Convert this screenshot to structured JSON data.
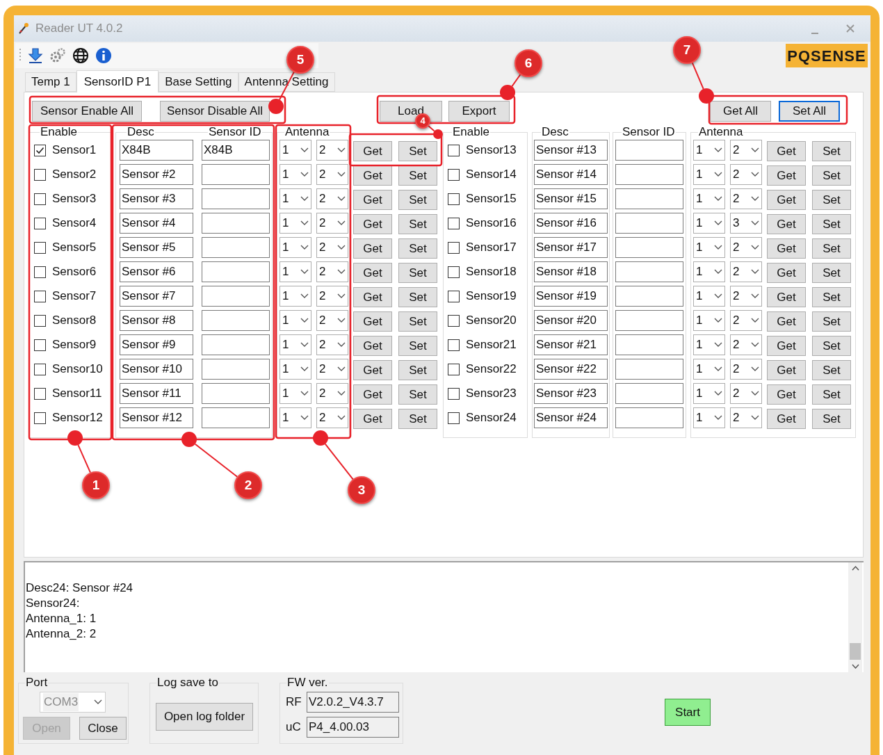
{
  "window": {
    "title": "Reader UT 4.0.2"
  },
  "logo": "PQSENSE",
  "tabs": [
    {
      "label": "Temp 1",
      "selected": false
    },
    {
      "label": "SensorID P1",
      "selected": true
    },
    {
      "label": "Base Setting",
      "selected": false
    },
    {
      "label": "Antenna Setting",
      "selected": false
    }
  ],
  "top_buttons": [
    {
      "label": "Sensor Enable All",
      "focused": false
    },
    {
      "label": "Sensor Disable All",
      "focused": false
    },
    {
      "label": "Load",
      "focused": false
    },
    {
      "label": "Export",
      "focused": false
    },
    {
      "label": "Get All",
      "focused": false
    },
    {
      "label": "Set All",
      "focused": true
    }
  ],
  "left_group_headers": [
    "Enable",
    "Desc",
    "Sensor ID",
    "Antenna"
  ],
  "right_group_headers": [
    "Enable",
    "Desc",
    "Sensor ID",
    "Antenna"
  ],
  "sensors": [
    {
      "label": "Sensor1",
      "checked": true,
      "desc": "X84B",
      "sensor_id": "X84B",
      "antenna_1": "1",
      "antenna_2": "2",
      "get": "Get",
      "set": "Set"
    },
    {
      "label": "Sensor2",
      "checked": false,
      "desc": "Sensor #2",
      "antenna_1": "1",
      "antenna_2": "2",
      "get": "Get",
      "set": "Set"
    },
    {
      "label": "Sensor3",
      "checked": false,
      "desc": "Sensor #3",
      "antenna_1": "1",
      "antenna_2": "2",
      "get": "Get",
      "set": "Set"
    },
    {
      "label": "Sensor4",
      "checked": false,
      "desc": "Sensor #4",
      "antenna_1": "1",
      "antenna_2": "2",
      "get": "Get",
      "set": "Set"
    },
    {
      "label": "Sensor5",
      "checked": false,
      "desc": "Sensor #5",
      "antenna_1": "1",
      "antenna_2": "2",
      "get": "Get",
      "set": "Set"
    },
    {
      "label": "Sensor6",
      "checked": false,
      "desc": "Sensor #6",
      "antenna_1": "1",
      "antenna_2": "2",
      "get": "Get",
      "set": "Set"
    },
    {
      "label": "Sensor7",
      "checked": false,
      "desc": "Sensor #7",
      "antenna_1": "1",
      "antenna_2": "2",
      "get": "Get",
      "set": "Set"
    },
    {
      "label": "Sensor8",
      "checked": false,
      "desc": "Sensor #8",
      "antenna_1": "1",
      "antenna_2": "2",
      "get": "Get",
      "set": "Set"
    },
    {
      "label": "Sensor9",
      "checked": false,
      "desc": "Sensor #9",
      "antenna_1": "1",
      "antenna_2": "2",
      "get": "Get",
      "set": "Set"
    },
    {
      "label": "Sensor10",
      "checked": false,
      "desc": "Sensor #10",
      "antenna_1": "1",
      "antenna_2": "2",
      "get": "Get",
      "set": "Set"
    },
    {
      "label": "Sensor11",
      "checked": false,
      "desc": "Sensor #11",
      "antenna_1": "1",
      "antenna_2": "2",
      "get": "Get",
      "set": "Set"
    },
    {
      "label": "Sensor12",
      "checked": false,
      "desc": "Sensor #12",
      "antenna_1": "1",
      "antenna_2": "2",
      "get": "Get",
      "set": "Set"
    },
    {
      "label": "Sensor13",
      "checked": false,
      "desc": "Sensor #13",
      "antenna_1": "1",
      "antenna_2": "2",
      "get": "Get",
      "set": "Set"
    },
    {
      "label": "Sensor14",
      "checked": false,
      "desc": "Sensor #14",
      "antenna_1": "1",
      "antenna_2": "2",
      "get": "Get",
      "set": "Set"
    },
    {
      "label": "Sensor15",
      "checked": false,
      "desc": "Sensor #15",
      "antenna_1": "1",
      "antenna_2": "2",
      "get": "Get",
      "set": "Set"
    },
    {
      "label": "Sensor16",
      "checked": false,
      "desc": "Sensor #16",
      "antenna_1": "1",
      "antenna_2": "3",
      "get": "Get",
      "set": "Set"
    },
    {
      "label": "Sensor17",
      "checked": false,
      "desc": "Sensor #17",
      "antenna_1": "1",
      "antenna_2": "2",
      "get": "Get",
      "set": "Set"
    },
    {
      "label": "Sensor18",
      "checked": false,
      "desc": "Sensor #18",
      "antenna_1": "1",
      "antenna_2": "2",
      "get": "Get",
      "set": "Set"
    },
    {
      "label": "Sensor19",
      "checked": false,
      "desc": "Sensor #19",
      "antenna_1": "1",
      "antenna_2": "2",
      "get": "Get",
      "set": "Set"
    },
    {
      "label": "Sensor20",
      "checked": false,
      "desc": "Sensor #20",
      "antenna_1": "1",
      "antenna_2": "2",
      "get": "Get",
      "set": "Set"
    },
    {
      "label": "Sensor21",
      "checked": false,
      "desc": "Sensor #21",
      "antenna_1": "1",
      "antenna_2": "2",
      "get": "Get",
      "set": "Set"
    },
    {
      "label": "Sensor22",
      "checked": false,
      "desc": "Sensor #22",
      "antenna_1": "1",
      "antenna_2": "2",
      "get": "Get",
      "set": "Set"
    },
    {
      "label": "Sensor23",
      "checked": false,
      "desc": "Sensor #23",
      "antenna_1": "1",
      "antenna_2": "2",
      "get": "Get",
      "set": "Set"
    },
    {
      "label": "Sensor24",
      "checked": false,
      "desc": "Sensor #24",
      "antenna_1": "1",
      "antenna_2": "2",
      "get": "Get",
      "set": "Set"
    }
  ],
  "log_lines": [
    "Desc24: Sensor #24",
    "Sensor24:",
    "Antenna_1: 1",
    "Antenna_2: 2"
  ],
  "port": {
    "legend": "Port",
    "com": {
      "value": "COM3",
      "disabled": true
    },
    "buttons": [
      {
        "label": "Open",
        "disabled": true
      },
      {
        "label": "Close",
        "disabled": false
      }
    ]
  },
  "log_save": {
    "legend": "Log save to",
    "button": "Open log folder"
  },
  "fw": {
    "legend": "FW ver.",
    "fields": [
      {
        "label": "RF",
        "value": "V2.0.2_V4.3.7"
      },
      {
        "label": "uC",
        "value": "P4_4.00.03"
      }
    ]
  },
  "start_button": "Start",
  "annotations": [
    {
      "number": "1"
    },
    {
      "number": "2"
    },
    {
      "number": "3"
    },
    {
      "number": "4"
    },
    {
      "number": "5"
    },
    {
      "number": "6"
    },
    {
      "number": "7"
    }
  ]
}
